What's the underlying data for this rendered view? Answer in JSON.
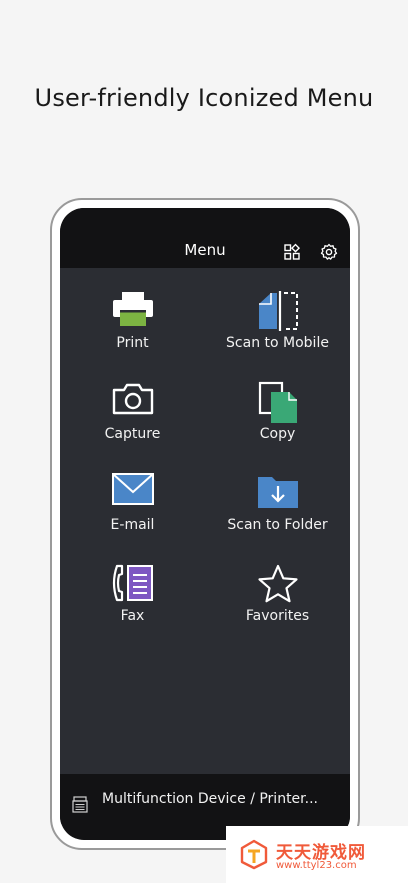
{
  "headline": "User-friendly Iconized Menu",
  "topbar": {
    "title": "Menu",
    "icons": [
      "grid-icon",
      "gear-icon"
    ]
  },
  "menu": {
    "items": [
      {
        "label": "Print",
        "icon": "printer-icon"
      },
      {
        "label": "Scan to Mobile",
        "icon": "scan-to-mobile-icon"
      },
      {
        "label": "Capture",
        "icon": "camera-icon"
      },
      {
        "label": "Copy",
        "icon": "copy-icon"
      },
      {
        "label": "E-mail",
        "icon": "envelope-icon"
      },
      {
        "label": "Scan to Folder",
        "icon": "folder-download-icon"
      },
      {
        "label": "Fax",
        "icon": "fax-icon"
      },
      {
        "label": "Favorites",
        "icon": "star-icon"
      }
    ]
  },
  "bottombar": {
    "device_label": "Multifunction Device / Printer..."
  },
  "watermark": {
    "text": "天天游戏网",
    "url": "www.ttyl23.com"
  },
  "colors": {
    "menu_bg": "#2b2d33",
    "bar_bg": "#121214",
    "accent_green": "#7cb342",
    "accent_blue": "#4a86c8",
    "accent_teal_green": "#3aa876",
    "accent_purple": "#7e57c2",
    "watermark": "#f05a3a"
  }
}
